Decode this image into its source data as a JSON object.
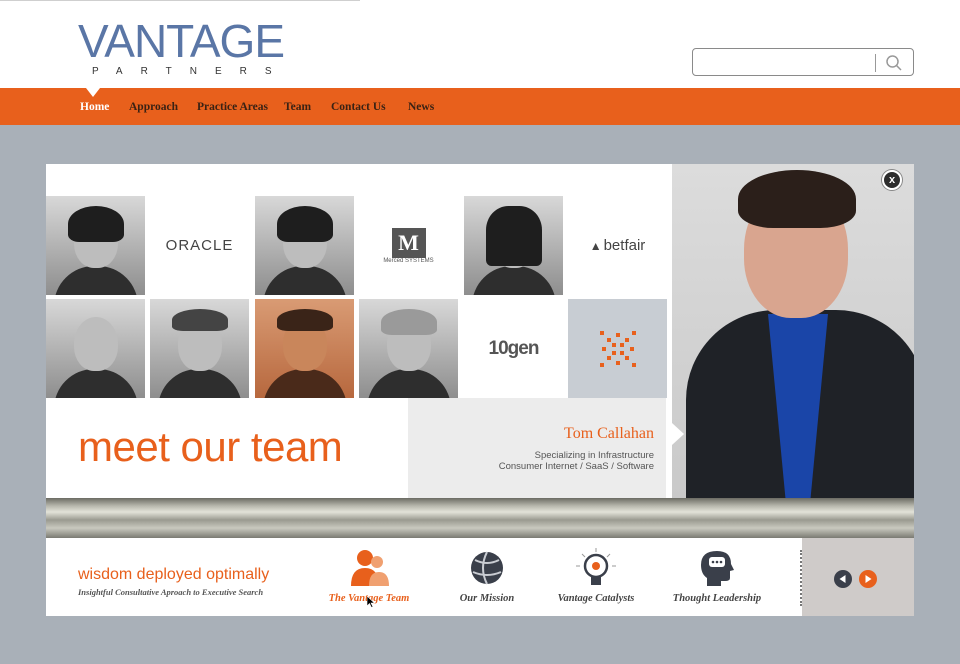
{
  "brand": {
    "name": "VANTAGE",
    "sub": "PARTNERS",
    "color": "#5a76a6",
    "accent": "#e8601c"
  },
  "search": {
    "value": "",
    "placeholder": "",
    "icon": "search-icon"
  },
  "nav": {
    "items": [
      {
        "label": "Home",
        "active": true
      },
      {
        "label": "Approach"
      },
      {
        "label": "Practice Areas"
      },
      {
        "label": "Team"
      },
      {
        "label": "Contact Us"
      },
      {
        "label": "News"
      }
    ]
  },
  "grid": {
    "logos": {
      "oracle": "ORACLE",
      "merced_mark": "M",
      "merced_text": "Merced SYSTEMS",
      "betfair": "betfair",
      "tengen": "10gen"
    }
  },
  "team": {
    "heading": "meet our team",
    "featured": {
      "name": "Tom Callahan",
      "line1": "Specializing in Infrastructure",
      "line2": "Consumer Internet / SaaS / Software"
    },
    "close_label": "x"
  },
  "bottom": {
    "tagline": "wisdom deployed optimally",
    "subtagline": "Insightful Consultative Aproach to Executive Search",
    "features": [
      {
        "label": "The Vantage Team",
        "icon": "team-icon",
        "active": true
      },
      {
        "label": "Our Mission",
        "icon": "globe-icon"
      },
      {
        "label": "Vantage Catalysts",
        "icon": "lightbulb-icon"
      },
      {
        "label": "Thought Leadership",
        "icon": "thinking-head-icon"
      }
    ],
    "prev_icon": "arrow-left-icon",
    "next_icon": "arrow-right-icon"
  }
}
